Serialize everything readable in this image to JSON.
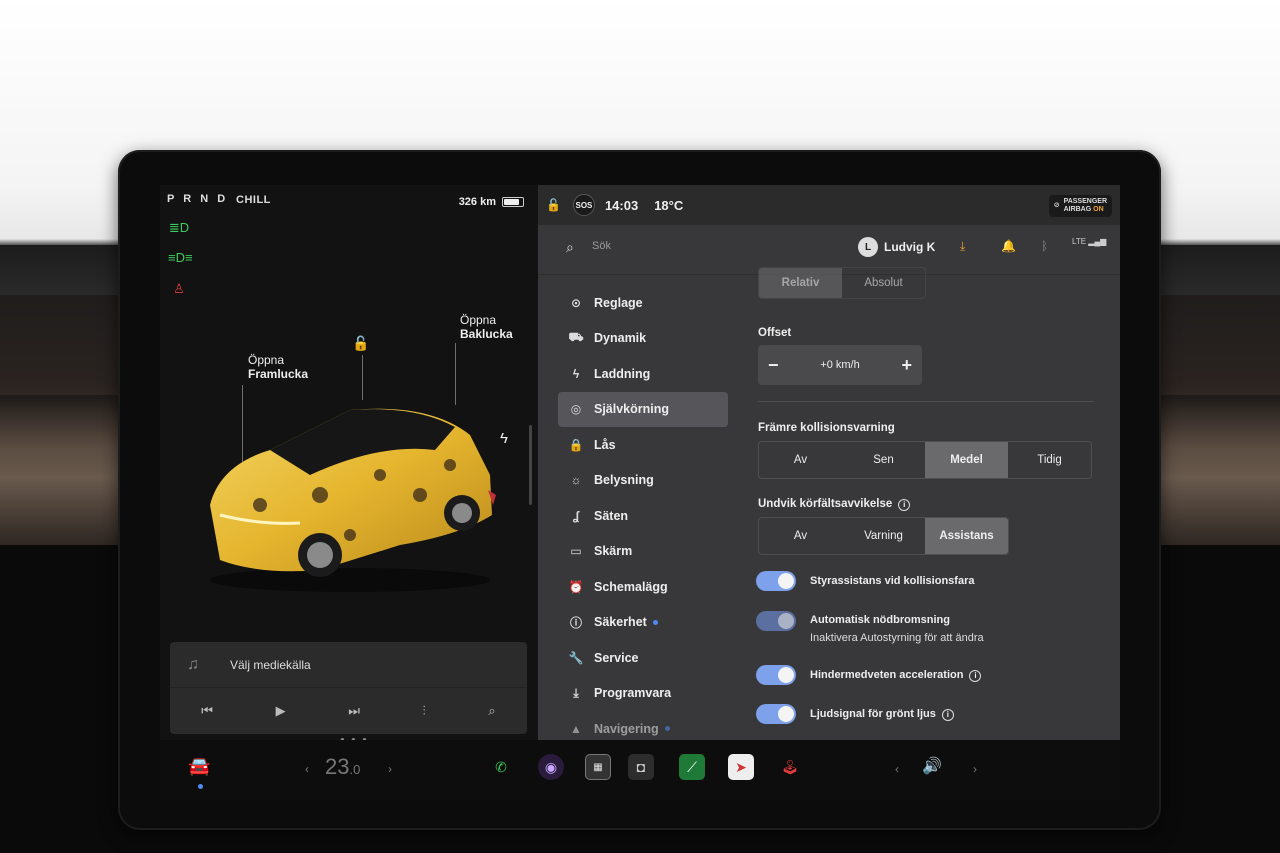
{
  "left": {
    "gear": "P R N D",
    "drive_mode": "CHILL",
    "range": "326 km",
    "indicators": [
      "headlights-icon",
      "parking-lights-icon",
      "seatbelt-warning-icon"
    ],
    "front_trunk": {
      "line1": "Öppna",
      "line2": "Framlucka"
    },
    "rear_trunk": {
      "line1": "Öppna",
      "line2": "Baklucka"
    },
    "media": {
      "source_label": "Välj mediekälla"
    }
  },
  "status": {
    "sos": "SOS",
    "time": "14:03",
    "temperature": "18°C",
    "airbag_line1": "PASSENGER",
    "airbag_line2": "AIRBAG",
    "airbag_state": "ON"
  },
  "header": {
    "search_placeholder": "Sök",
    "user_name": "Ludvig K",
    "user_initial": "L",
    "network": "LTE"
  },
  "nav": [
    {
      "label": "Reglage",
      "icon": "toggle-icon"
    },
    {
      "label": "Dynamik",
      "icon": "car-icon"
    },
    {
      "label": "Laddning",
      "icon": "bolt-icon"
    },
    {
      "label": "Självkörning",
      "icon": "steering-wheel-icon",
      "active": true
    },
    {
      "label": "Lås",
      "icon": "lock-icon"
    },
    {
      "label": "Belysning",
      "icon": "sun-icon"
    },
    {
      "label": "Säten",
      "icon": "seat-icon"
    },
    {
      "label": "Skärm",
      "icon": "display-icon"
    },
    {
      "label": "Schemalägg",
      "icon": "alarm-icon"
    },
    {
      "label": "Säkerhet",
      "icon": "info-icon"
    },
    {
      "label": "Service",
      "icon": "wrench-icon"
    },
    {
      "label": "Programvara",
      "icon": "download-icon"
    },
    {
      "label": "Navigering",
      "icon": "navigation-icon"
    }
  ],
  "content": {
    "speed_mode": {
      "options": [
        "Relativ",
        "Absolut"
      ],
      "selected": "Relativ"
    },
    "offset_label": "Offset",
    "offset_value": "+0 km/h",
    "fcw_label": "Främre kollisionsvarning",
    "fcw": {
      "options": [
        "Av",
        "Sen",
        "Medel",
        "Tidig"
      ],
      "selected": "Medel"
    },
    "lane_label": "Undvik körfältsavvikelse",
    "lane": {
      "options": [
        "Av",
        "Varning",
        "Assistans"
      ],
      "selected": "Assistans"
    },
    "toggles": [
      {
        "label": "Styrassistans vid kollisionsfara",
        "on": true
      },
      {
        "label": "Automatisk nödbromsning",
        "sub": "Inaktivera Autostyrning för att ändra",
        "on": true
      },
      {
        "label": "Hindermedveten acceleration",
        "on": true,
        "info": true
      },
      {
        "label": "Ljudsignal för grönt ljus",
        "on": true,
        "info": true
      }
    ]
  },
  "dock": {
    "temperature": "23.0",
    "temperature_int": "23",
    "temperature_dec": ".0"
  },
  "colors": {
    "accent_blue": "#7da1ea",
    "indicator_green": "#3ecc5c",
    "warning_red": "#e03a3a",
    "airbag_on": "#f2a22e"
  }
}
